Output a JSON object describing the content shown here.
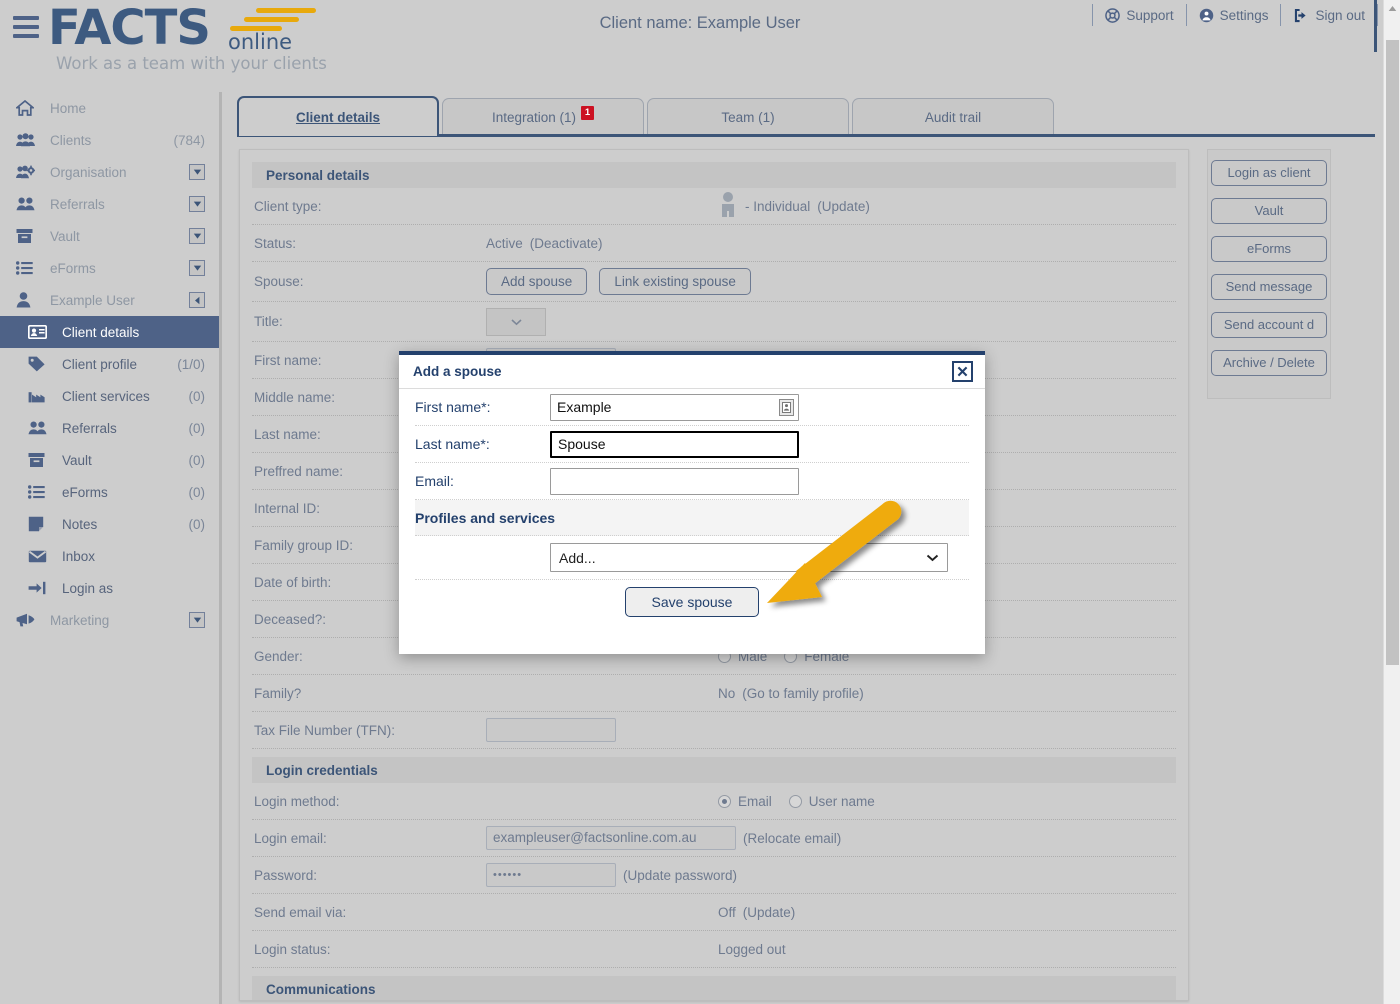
{
  "header": {
    "hamburger_icon": "hamburger-menu-icon",
    "logo_main": "FACTS",
    "logo_sub": "online",
    "logo_tagline": "Work as a team with your clients",
    "client_title": "Client name: Example User",
    "actions": [
      {
        "label": "Support",
        "icon": "lifebuoy-icon"
      },
      {
        "label": "Settings",
        "icon": "user-circle-icon"
      },
      {
        "label": "Sign out",
        "icon": "sign-out-icon"
      }
    ]
  },
  "sidebar": {
    "items": [
      {
        "label": "Home",
        "icon": "home-icon",
        "count": "",
        "caret": false,
        "sub": false,
        "active": false
      },
      {
        "label": "Clients",
        "icon": "users-icon",
        "count": "(784)",
        "caret": false,
        "sub": false,
        "active": false
      },
      {
        "label": "Organisation",
        "icon": "users-gear-icon",
        "count": "",
        "caret": true,
        "sub": false,
        "active": false
      },
      {
        "label": "Referrals",
        "icon": "two-users-icon",
        "count": "",
        "caret": true,
        "sub": false,
        "active": false
      },
      {
        "label": "Vault",
        "icon": "archive-box-icon",
        "count": "",
        "caret": true,
        "sub": false,
        "active": false
      },
      {
        "label": "eForms",
        "icon": "list-icon",
        "count": "",
        "caret": true,
        "sub": false,
        "active": false
      },
      {
        "label": "Example User",
        "icon": "person-icon",
        "count": "",
        "caret": "left",
        "sub": false,
        "active": false
      },
      {
        "label": "Client details",
        "icon": "id-card-icon",
        "count": "",
        "caret": false,
        "sub": true,
        "active": true
      },
      {
        "label": "Client profile",
        "icon": "tag-icon",
        "count": "(1/0)",
        "caret": false,
        "sub": true,
        "active": false
      },
      {
        "label": "Client services",
        "icon": "factory-icon",
        "count": "(0)",
        "caret": false,
        "sub": true,
        "active": false
      },
      {
        "label": "Referrals",
        "icon": "two-users-icon",
        "count": "(0)",
        "caret": false,
        "sub": true,
        "active": false
      },
      {
        "label": "Vault",
        "icon": "archive-box-icon",
        "count": "(0)",
        "caret": false,
        "sub": true,
        "active": false
      },
      {
        "label": "eForms",
        "icon": "list-icon",
        "count": "(0)",
        "caret": false,
        "sub": true,
        "active": false
      },
      {
        "label": "Notes",
        "icon": "note-icon",
        "count": "(0)",
        "caret": false,
        "sub": true,
        "active": false
      },
      {
        "label": "Inbox",
        "icon": "envelope-icon",
        "count": "",
        "caret": false,
        "sub": true,
        "active": false
      },
      {
        "label": "Login as",
        "icon": "login-arrow-icon",
        "count": "",
        "caret": false,
        "sub": true,
        "active": false
      },
      {
        "label": "Marketing",
        "icon": "megaphone-icon",
        "count": "",
        "caret": true,
        "sub": false,
        "active": false
      }
    ]
  },
  "tabs": [
    {
      "label": "Client details",
      "badge": "",
      "active": true
    },
    {
      "label": "Integration (1)",
      "badge": "1",
      "active": false
    },
    {
      "label": "Team (1)",
      "badge": "",
      "active": false
    },
    {
      "label": "Audit trail",
      "badge": "",
      "active": false
    }
  ],
  "panel": {
    "section_personal": "Personal details",
    "section_login": "Login credentials",
    "section_communications": "Communications",
    "rows": {
      "client_type_label": "Client type:",
      "client_type_value": "- Individual",
      "client_type_link": "(Update)",
      "status_label": "Status:",
      "status_value": "Active",
      "status_link": "(Deactivate)",
      "spouse_label": "Spouse:",
      "spouse_add_button": "Add spouse",
      "spouse_link_button": "Link existing spouse",
      "title_label": "Title:",
      "first_name_label": "First name:",
      "middle_name_label": "Middle name:",
      "last_name_label": "Last name:",
      "preferred_name_label": "Preffred name:",
      "internal_id_label": "Internal ID:",
      "family_group_id_label": "Family group ID:",
      "date_of_birth_label": "Date of birth:",
      "deceased_label": "Deceased?:",
      "gender_label": "Gender:",
      "gender_male": "Male",
      "gender_female": "Female",
      "family_label": "Family?",
      "family_value": "No",
      "family_link": "(Go to family profile)",
      "tfn_label": "Tax File Number (TFN):",
      "login_method_label": "Login method:",
      "login_method_email": "Email",
      "login_method_username": "User name",
      "login_email_label": "Login email:",
      "login_email_value": "exampleuser@factsonline.com.au",
      "login_email_link": "(Relocate email)",
      "password_label": "Password:",
      "password_value": "••••••",
      "password_link": "(Update password)",
      "send_email_via_label": "Send email via:",
      "send_email_via_value": "Off",
      "send_email_via_link": "(Update)",
      "login_status_label": "Login status:",
      "login_status_value": "Logged out"
    }
  },
  "rail": {
    "buttons": [
      "Login as client",
      "Vault",
      "eForms",
      "Send message",
      "Send account d",
      "Archive / Delete"
    ]
  },
  "modal": {
    "title": "Add a spouse",
    "close_icon": "close-x-icon",
    "first_name_label": "First name*:",
    "first_name_value": "Example",
    "first_name_autofill_icon": "contact-card-icon",
    "last_name_label": "Last name*:",
    "last_name_value": "Spouse",
    "email_label": "Email:",
    "email_value": "",
    "email_placeholder": "",
    "section_profiles": "Profiles and services",
    "add_select_value": "Add...",
    "save_button": "Save spouse"
  },
  "annotation": {
    "arrow_color": "#EFAB0E",
    "arrow_icon": "pointer-arrow-annotation"
  },
  "scrollbar": {
    "up_arrow_icon": "scroll-up-arrow-icon"
  },
  "colors": {
    "page_bg": "#CDCDCD",
    "brand_blue": "#3D5A80",
    "accent_navy": "#24416D",
    "sidebar_active": "#4E6287",
    "badge_red": "#CC1122",
    "annotation_gold": "#EFAB0E"
  }
}
